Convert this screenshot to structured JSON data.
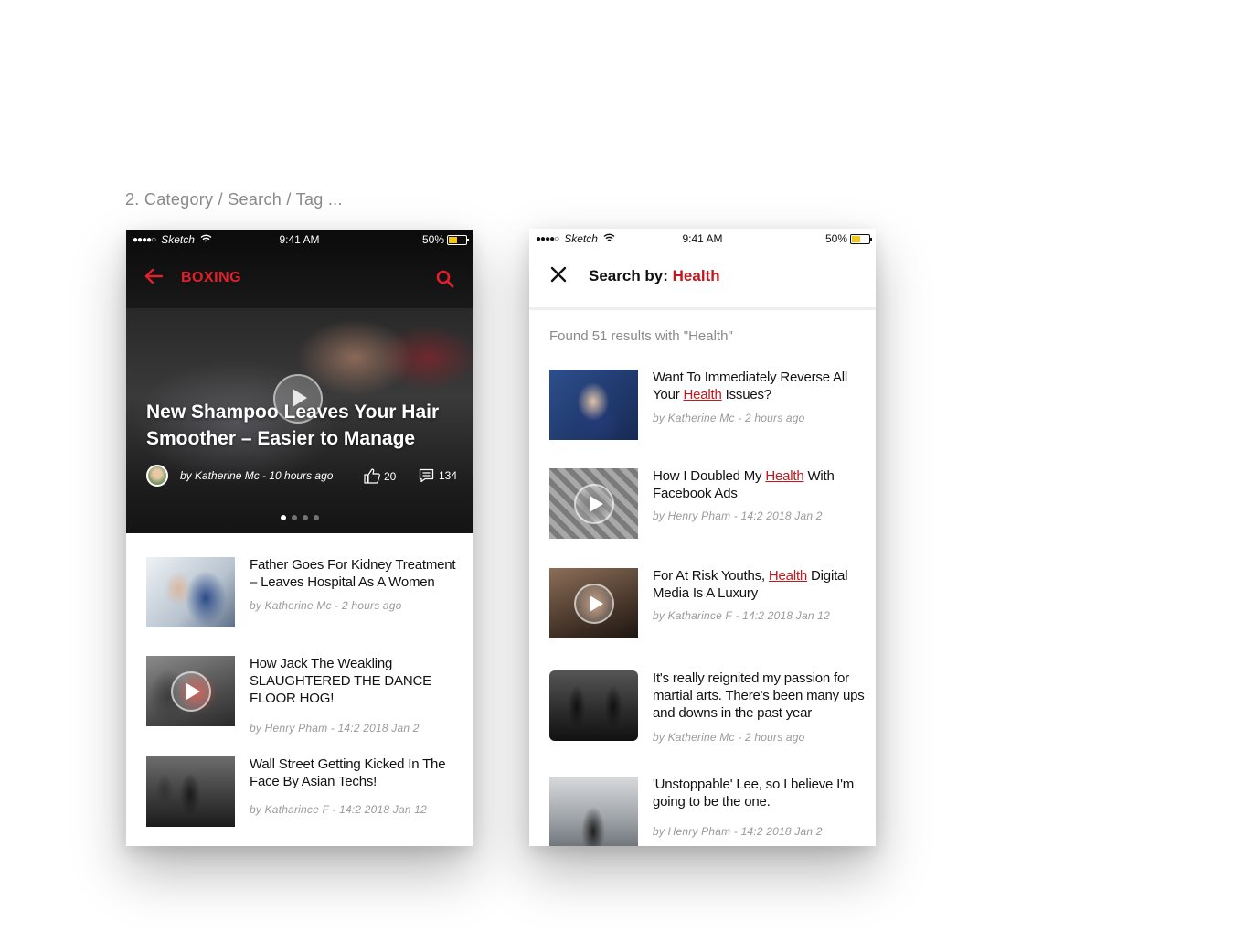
{
  "section_label": "2. Category / Search / Tag ...",
  "colors": {
    "accent": "#c4161c",
    "battery": "#f5c518"
  },
  "status_bar": {
    "carrier_dots": "●●●●○",
    "network": "Sketch",
    "time": "9:41 AM",
    "battery": "50%",
    "battery_level": 0.5
  },
  "category_screen": {
    "back_icon": "arrow-left-icon",
    "category": "BOXING",
    "search_icon": "search-icon",
    "hero": {
      "title": "New Shampoo Leaves Your Hair Smoother – Easier to Manage",
      "byline": "by  Katherine Mc  -  10 hours ago",
      "likes": "20",
      "comments": "134",
      "slides": 4,
      "active_slide": 1
    },
    "articles": [
      {
        "title": "Father Goes For Kidney Treatment – Leaves Hospital As A Women",
        "meta": "by  Katherine Mc  -  2 hours ago",
        "video": false
      },
      {
        "title": "How Jack The Weakling SLAUGHTERED THE DANCE FLOOR HOG!",
        "meta": "by  Henry Pham   -  14:2 2018 Jan 2",
        "video": true
      },
      {
        "title": "Wall Street Getting Kicked In The Face By Asian Techs!",
        "meta": "by  Katharince F   -  14:2 2018 Jan 12",
        "video": false
      }
    ]
  },
  "search_screen": {
    "close_icon": "close-icon",
    "title_prefix": "Search by: ",
    "keyword": "Health",
    "found_text": "Found 51 results with \"Health\"",
    "results": [
      {
        "pre": "Want To Immediately Reverse All Your ",
        "kw": "Health",
        "post": " Issues?",
        "meta": "by  Katherine Mc  -  2 hours ago",
        "video": false
      },
      {
        "pre": "How I Doubled My ",
        "kw": "Health",
        "post": " With Facebook Ads",
        "meta": "by  Henry Pham   -  14:2 2018 Jan 2",
        "video": true
      },
      {
        "pre": "For At Risk Youths, ",
        "kw": "Health",
        "post": " Digital Media Is A Luxury",
        "meta": "by  Katharince F   -  14:2 2018 Jan 12",
        "video": true
      },
      {
        "pre": "It's really reignited my passion for martial arts. There's been many ups and downs in the past year",
        "kw": "",
        "post": "",
        "meta": "by  Katherine Mc  -  2 hours ago",
        "video": false
      },
      {
        "pre": "'Unstoppable' Lee, so I believe I'm going to be the one.",
        "kw": "",
        "post": "",
        "meta": "by  Henry Pham   -  14:2 2018 Jan 2",
        "video": false
      }
    ]
  }
}
